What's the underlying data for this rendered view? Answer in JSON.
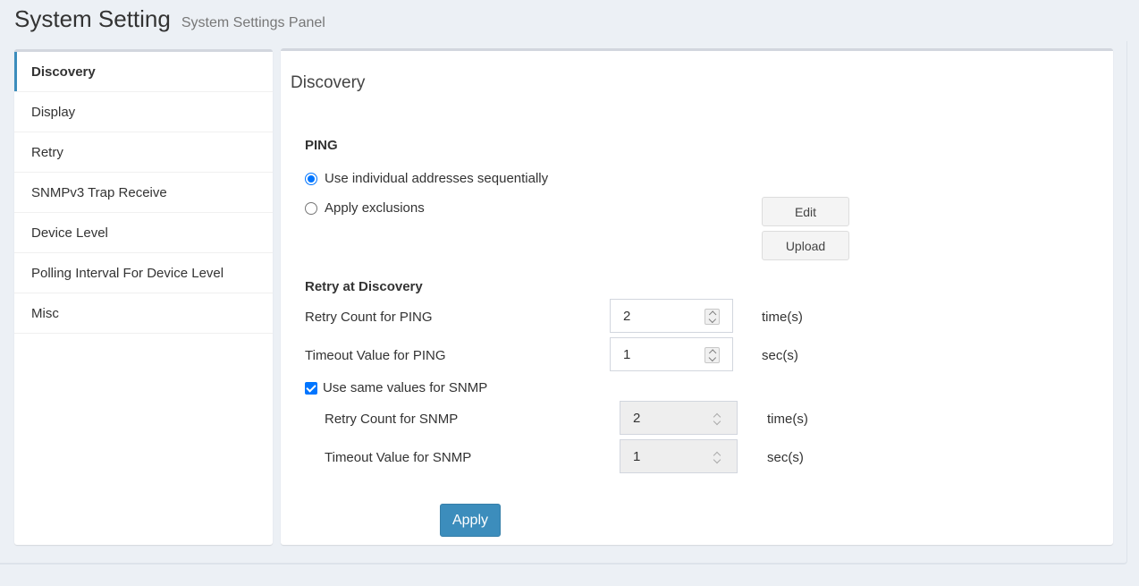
{
  "header": {
    "title": "System Setting",
    "subtitle": "System Settings Panel"
  },
  "sidebar": {
    "items": [
      {
        "label": "Discovery",
        "active": true
      },
      {
        "label": "Display"
      },
      {
        "label": "Retry"
      },
      {
        "label": "SNMPv3 Trap Receive"
      },
      {
        "label": "Device Level"
      },
      {
        "label": "Polling Interval For Device Level"
      },
      {
        "label": "Misc"
      }
    ]
  },
  "main": {
    "title": "Discovery",
    "ping": {
      "heading": "PING",
      "option_sequential": "Use individual addresses sequentially",
      "option_exclusions": "Apply exclusions",
      "selected": "sequential",
      "edit_label": "Edit",
      "upload_label": "Upload"
    },
    "retry": {
      "heading": "Retry at Discovery",
      "ping_retry_label": "Retry Count for PING",
      "ping_retry_value": "2",
      "ping_retry_unit": "time(s)",
      "ping_timeout_label": "Timeout Value for PING",
      "ping_timeout_value": "1",
      "ping_timeout_unit": "sec(s)",
      "same_values_label": "Use same values for SNMP",
      "same_values_checked": true,
      "snmp_retry_label": "Retry Count for SNMP",
      "snmp_retry_value": "2",
      "snmp_retry_unit": "time(s)",
      "snmp_timeout_label": "Timeout Value for SNMP",
      "snmp_timeout_value": "1",
      "snmp_timeout_unit": "sec(s)"
    },
    "apply_label": "Apply"
  },
  "colors": {
    "primary": "#3c8dbc",
    "accent_control": "#0075ff",
    "background": "#ecf0f5"
  }
}
